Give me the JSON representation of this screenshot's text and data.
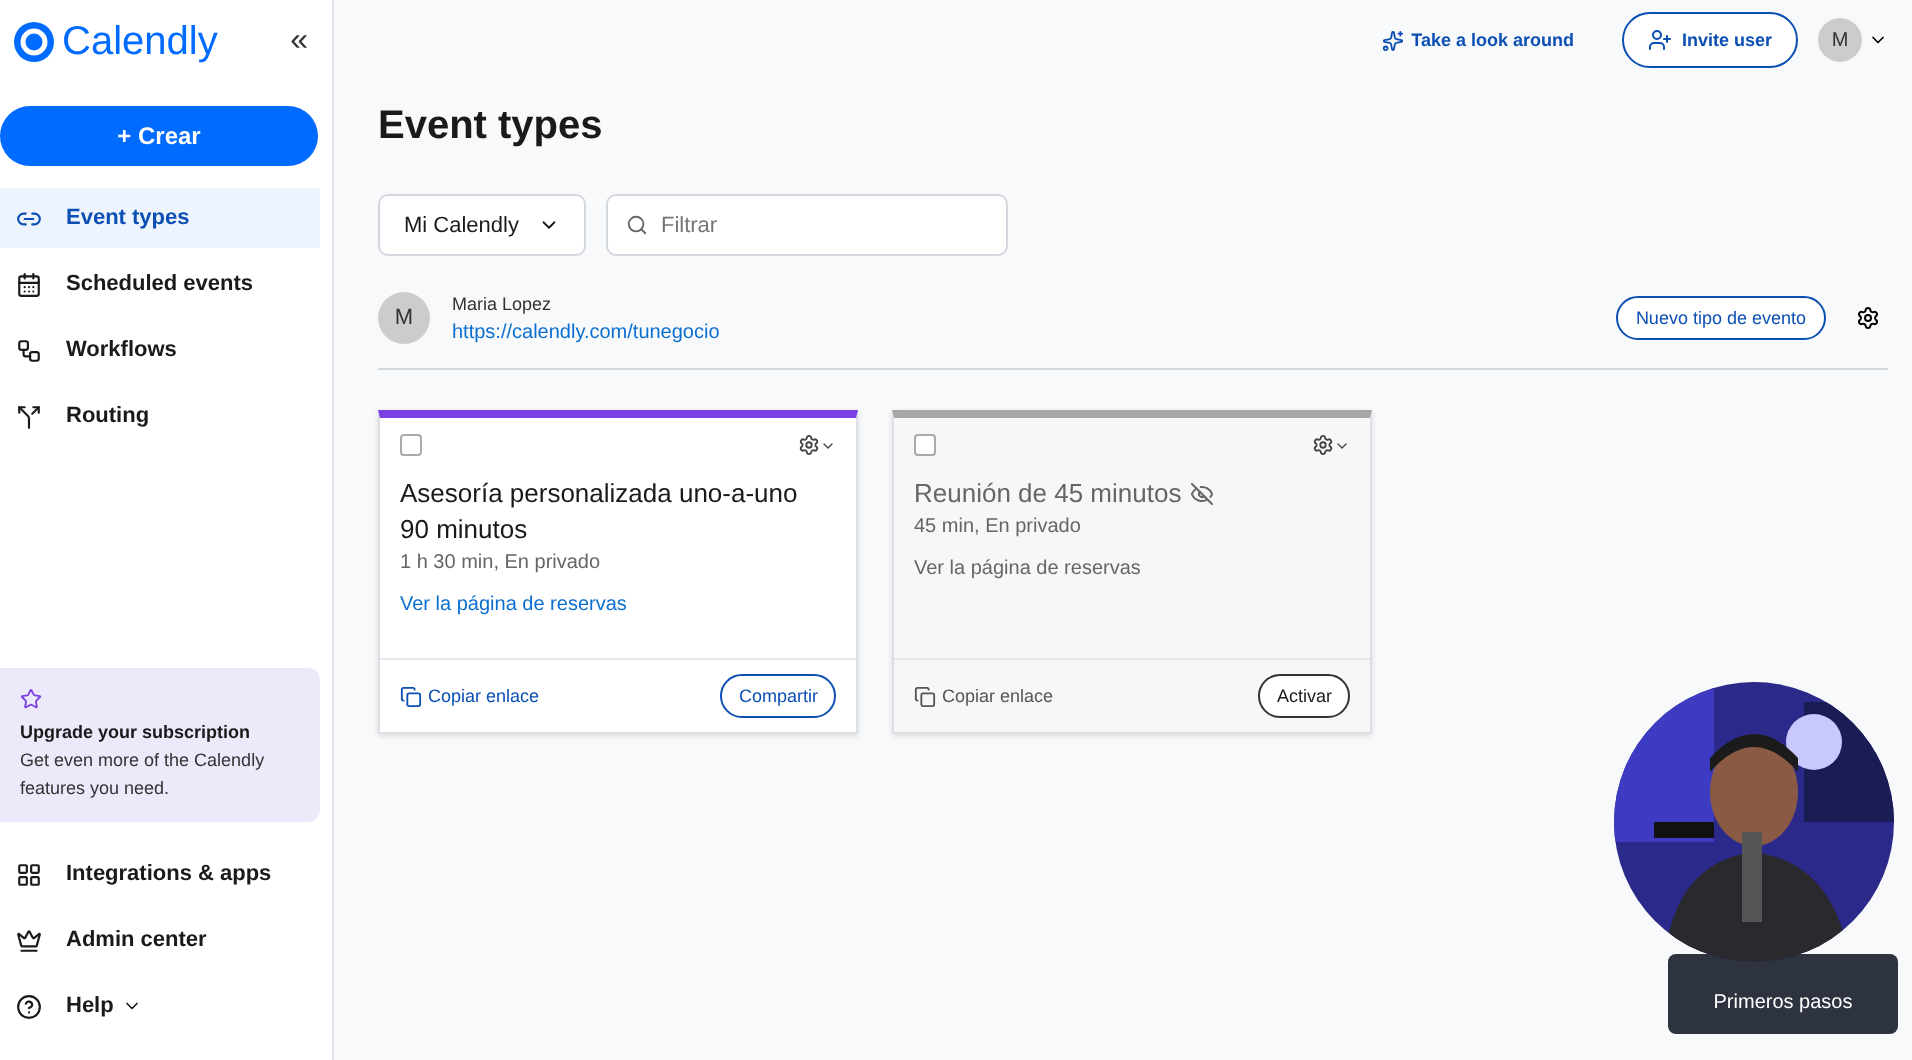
{
  "sidebar": {
    "brand": "Calendly",
    "collapse": "«",
    "create_button": "+ Crear",
    "items": [
      {
        "label": "Event types",
        "selected": true
      },
      {
        "label": "Scheduled events",
        "selected": false
      },
      {
        "label": "Workflows",
        "selected": false
      },
      {
        "label": "Routing",
        "selected": false
      }
    ],
    "upgrade": {
      "title": "Upgrade your subscription",
      "text": "Get even more of the Calendly features you need."
    },
    "bottom_items": [
      {
        "label": "Integrations & apps",
        "has_caret": false
      },
      {
        "label": "Admin center",
        "has_caret": false
      },
      {
        "label": "Help",
        "has_caret": true
      }
    ]
  },
  "topbar": {
    "tour": "Take a look around",
    "invite": "Invite user",
    "avatar": "M"
  },
  "page_title": "Event types",
  "filters": {
    "dropdown": "Mi Calendly",
    "search_placeholder": "Filtrar"
  },
  "user": {
    "avatar": "M",
    "name": "Maria Lopez",
    "url": "https://calendly.com/tunegocio",
    "new_button": "Nuevo tipo de evento"
  },
  "cards": [
    {
      "title": "Asesoría personalizada uno-a-uno 90 minutos",
      "details": "1 h 30 min, En privado",
      "link": "Ver la página de reservas",
      "copy": "Copiar enlace",
      "action": "Compartir",
      "active": true,
      "checked": false,
      "color": "#7b3fe4"
    },
    {
      "title": "Reunión de 45 minutos",
      "details": "45 min, En privado",
      "link": "Ver la página de reservas",
      "copy": "Copiar enlace",
      "action": "Activar",
      "active": false,
      "checked": false,
      "color": "#a6a6a6"
    }
  ],
  "help_button": "Primeros pasos"
}
